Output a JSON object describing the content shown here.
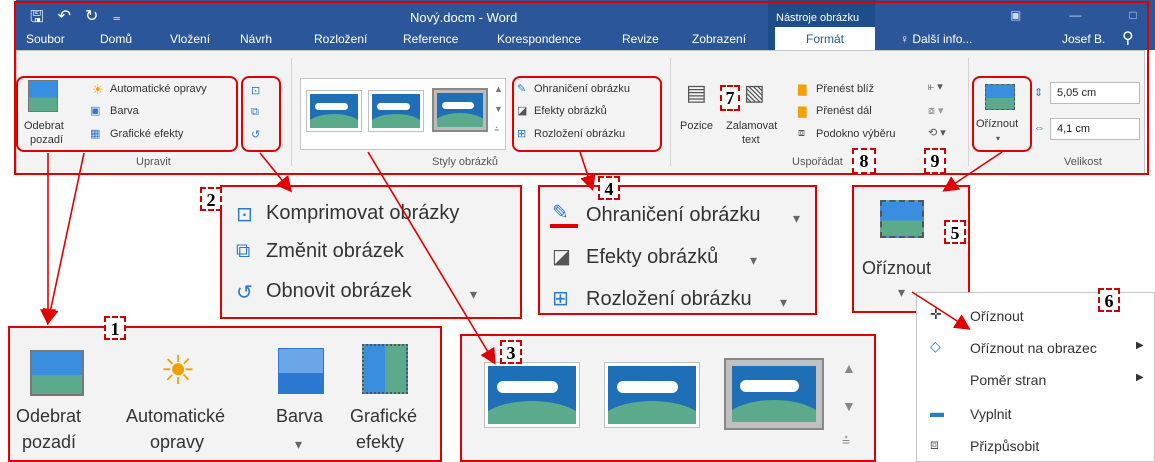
{
  "title_bar": {
    "doc_title": "Nový.docm - Word",
    "contextual_label": "Nástroje obrázku",
    "user": "Josef B."
  },
  "tabs": [
    "Soubor",
    "Domů",
    "Vložení",
    "Návrh",
    "Rozložení",
    "Reference",
    "Korespondence",
    "Revize",
    "Zobrazení",
    "Formát",
    "Další info..."
  ],
  "ribbon": {
    "upravit": {
      "remove_bg": [
        "Odebrat",
        "pozadí"
      ],
      "auto_fix": "Automatické opravy",
      "color": "Barva",
      "effects": "Grafické efekty",
      "label": "Upravit"
    },
    "styles": {
      "label": "Styly obrázků"
    },
    "border": {
      "outline": "Ohraničení obrázku",
      "effects": "Efekty obrázků",
      "layout": "Rozložení obrázku"
    },
    "arrange": {
      "position": "Pozice",
      "wrap": [
        "Zalamovat",
        "text"
      ],
      "forward": "Přenést blíž",
      "backward": "Přenést dál",
      "pane": "Podokno výběru",
      "label": "Uspořádat"
    },
    "size": {
      "crop": "Oříznout",
      "height": "5,05 cm",
      "width": "4,1 cm",
      "label": "Velikost"
    }
  },
  "callouts": [
    "1",
    "2",
    "3",
    "4",
    "5",
    "6",
    "7",
    "8",
    "9"
  ],
  "panel2": [
    "Komprimovat obrázky",
    "Změnit obrázek",
    "Obnovit obrázek"
  ],
  "panel4": [
    "Ohraničení obrázku",
    "Efekty obrázků",
    "Rozložení obrázku"
  ],
  "panel5": {
    "crop": "Oříznout"
  },
  "panel1": {
    "remove_bg": [
      "Odebrat",
      "pozadí"
    ],
    "auto": [
      "Automatické",
      "opravy"
    ],
    "color": "Barva",
    "effects": [
      "Grafické",
      "efekty"
    ]
  },
  "panel6": [
    "Oříznout",
    "Oříznout na obrazec",
    "Poměr stran",
    "Vyplnit",
    "Přizpůsobit"
  ]
}
